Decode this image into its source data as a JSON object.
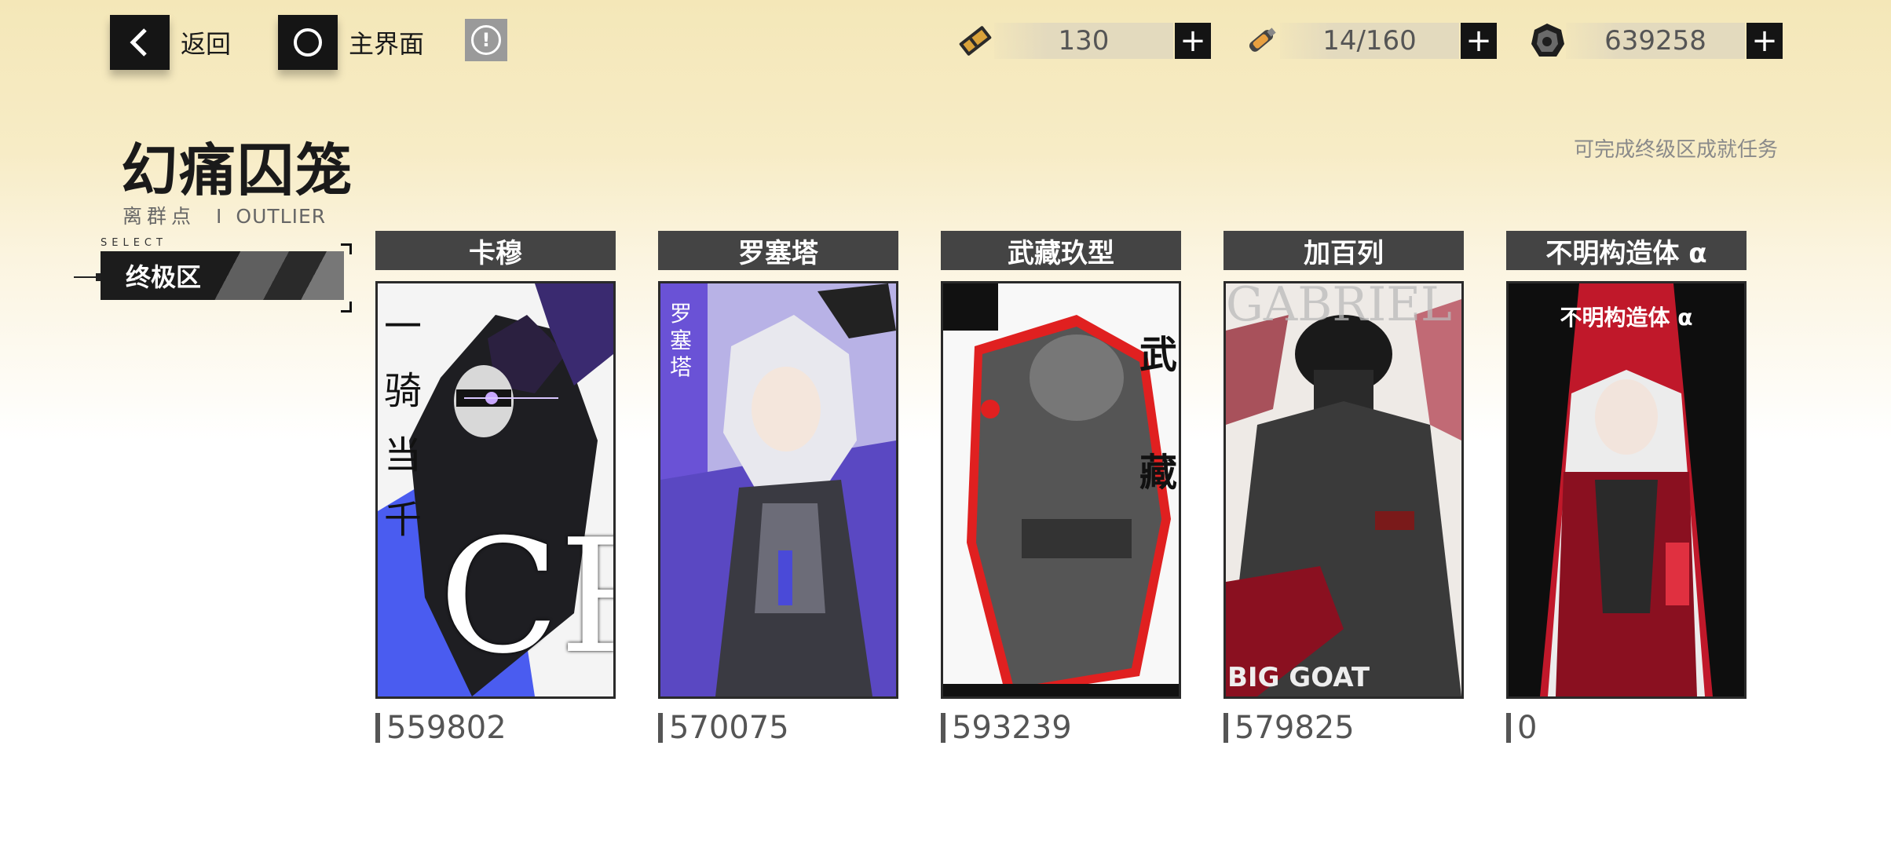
{
  "topbar": {
    "back_label": "返回",
    "home_label": "主界面",
    "alert_symbol": "!"
  },
  "resources": [
    {
      "icon": "stamina-ticket-icon",
      "value": "130"
    },
    {
      "icon": "serum-vial-icon",
      "value": "14/160"
    },
    {
      "icon": "coin-icon",
      "value": "639258"
    }
  ],
  "resource_plus": "+",
  "page": {
    "title": "幻痛囚笼",
    "subtitle_cn": "离群点",
    "subtitle_sep": "I",
    "subtitle_en": "OUTLIER",
    "hint": "可完成终级区成就任务"
  },
  "select": {
    "caption": "SELECT",
    "label": "终极区"
  },
  "cards": [
    {
      "name": "卡穆",
      "score": "559802",
      "art_text": "一 骑 当 千",
      "art_big": "CR",
      "accent": "#4a5cf0"
    },
    {
      "name": "罗塞塔",
      "score": "570075",
      "art_text": "罗塞塔",
      "accent": "#6a52d6"
    },
    {
      "name": "武藏玖型",
      "score": "593239",
      "art_text": "武 藏",
      "accent": "#e02020"
    },
    {
      "name": "加百列",
      "score": "579825",
      "art_text": "GABRIEL",
      "art_bottom": "BIG GOAT",
      "accent": "#a3142a"
    },
    {
      "name": "不明构造体 α",
      "score": "0",
      "art_text": "不明构造体 α",
      "accent": "#c0182a"
    }
  ]
}
